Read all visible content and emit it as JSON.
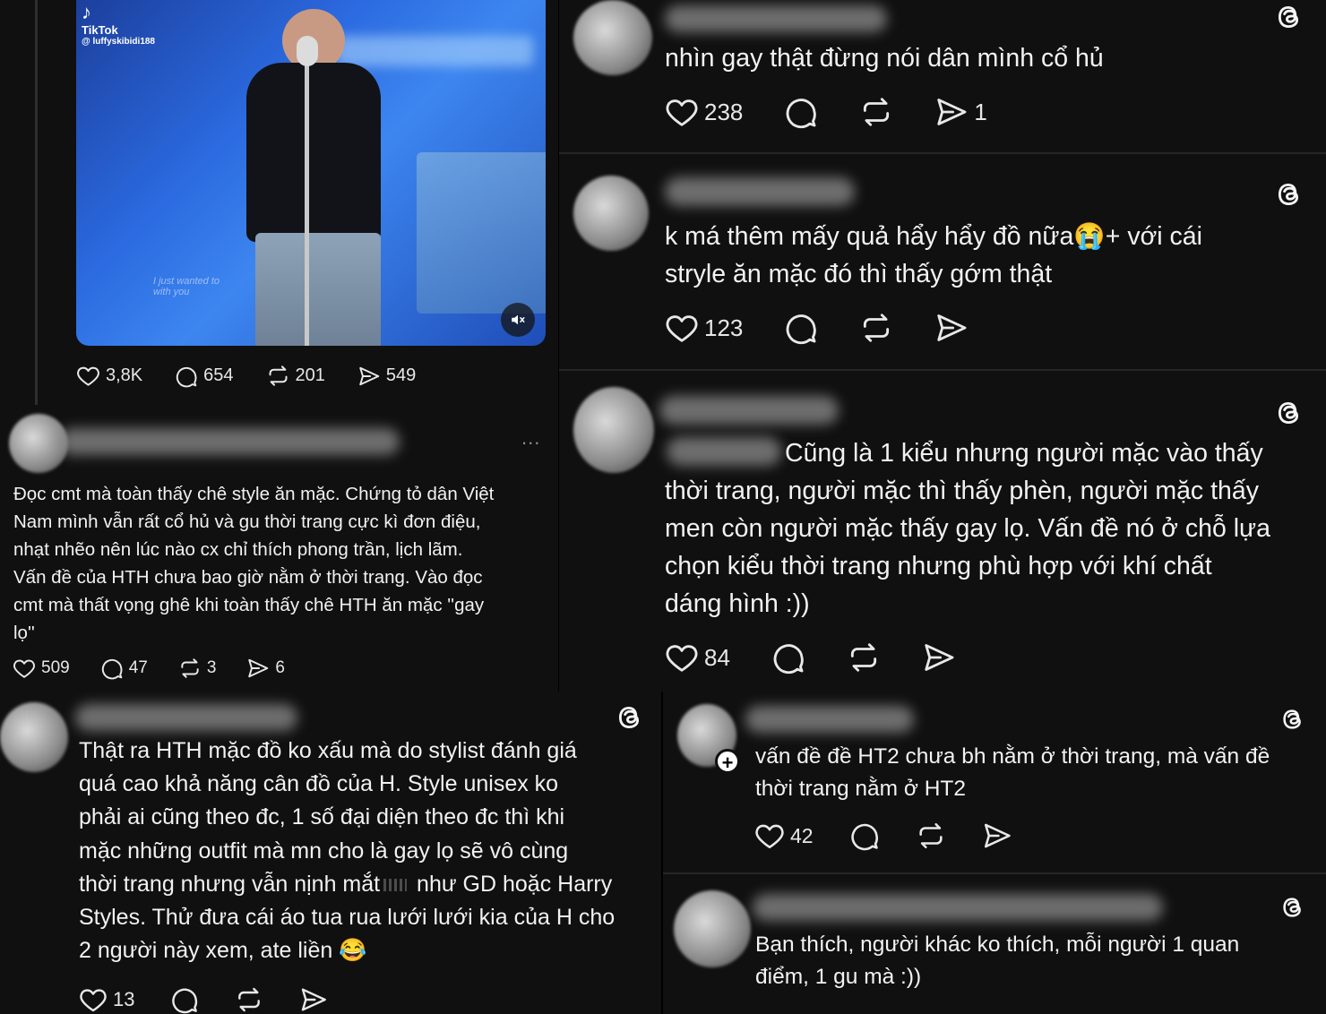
{
  "colors": {
    "background": "#101010",
    "text": "#f2f2f2",
    "muted": "#8e8e8e",
    "divider": "#262626"
  },
  "left": {
    "video": {
      "watermark_brand": "TikTok",
      "watermark_handle": "@ luffyskibidi188",
      "caption": "I just wanted to\nwith you",
      "mute_icon": "speaker-muted-icon"
    },
    "post_actions": {
      "likes": "3,8K",
      "comments": "654",
      "reposts": "201",
      "shares": "549"
    },
    "comment1": {
      "text": "Đọc cmt mà toàn thấy chê style ăn mặc. Chứng tỏ dân Việt\nNam mình vẫn rất cổ hủ và gu thời trang cực kì đơn điệu,\nnhạt nhẽo nên lúc nào cx chỉ thích phong trần, lịch lãm.\nVấn đề của HTH chưa bao giờ nằm ở thời trang. Vào đọc\ncmt mà thất vọng ghê khi toàn thấy chê HTH ăn mặc ''gay\nlọ''",
      "more": "...",
      "likes": "509",
      "comments": "47",
      "reposts": "3",
      "shares": "6"
    },
    "comment2": {
      "text_part1": "Thật ra HTH mặc đồ ko xấu mà do stylist đánh giá\nquá cao khả năng cân đồ của H. Style unisex ko\nphải ai cũng theo đc, 1 số đại diện theo đc thì khi\nmặc những outfit mà mn cho là gay lọ sẽ vô cùng\nthời trang nhưng vẫn nịnh mắt",
      "text_part2": " như GD hoặc Harry\nStyles. Thử đưa cái áo tua rua lưới lưới kia của H cho\n2 người này xem, ate liền ",
      "emoji": "😂",
      "likes": "13"
    }
  },
  "right": {
    "c1": {
      "text": "nhìn gay thật đừng nói dân mình cổ hủ",
      "likes": "238",
      "shares": "1"
    },
    "c2": {
      "text": "k má thêm mấy quả hẩy hẩy đồ nữa😭+ với cái\nstryle ăn mặc đó thì thấy gớm thật",
      "likes": "123"
    },
    "c3": {
      "text": "Cũng là 1 kiểu nhưng người mặc vào thấy",
      "text_rest": "thời trang, người mặc thì thấy phèn, người mặc thấy\nmen còn người mặc thấy gay lọ. Vấn đề nó ở chỗ lựa\nchọn kiểu thời trang nhưng phù hợp với khí chất\ndáng hình :))",
      "likes": "84"
    },
    "c4": {
      "text": "vấn đề đề HT2 chưa bh nằm ở thời trang, mà vấn đề\nthời trang nằm ở HT2",
      "likes": "42",
      "follow": "+"
    },
    "c5": {
      "text": "Bạn thích, người khác ko thích, mỗi người 1 quan\nđiểm, 1 gu mà :))"
    }
  },
  "icons": {
    "like": "heart-icon",
    "comment": "comment-icon",
    "repost": "repost-icon",
    "share": "send-icon",
    "threads": "threads-logo-icon",
    "more": "more-dots-icon"
  }
}
